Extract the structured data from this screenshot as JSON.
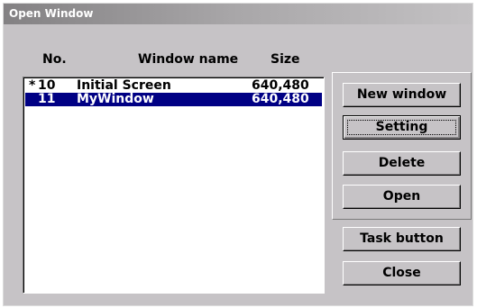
{
  "window": {
    "title": "Open Window"
  },
  "columns": {
    "no": "No.",
    "name": "Window name",
    "size": "Size"
  },
  "rows": [
    {
      "mark": "*",
      "no": "10",
      "name": "Initial Screen",
      "size": "640,480",
      "selected": false
    },
    {
      "mark": "",
      "no": "11",
      "name": "MyWindow",
      "size": "640,480",
      "selected": true
    }
  ],
  "buttons": {
    "new_window": "New window",
    "setting": "Setting",
    "delete": "Delete",
    "open": "Open",
    "task_button": "Task button",
    "close": "Close"
  },
  "colors": {
    "selection": "#000084",
    "face": "#c6c3c6"
  }
}
